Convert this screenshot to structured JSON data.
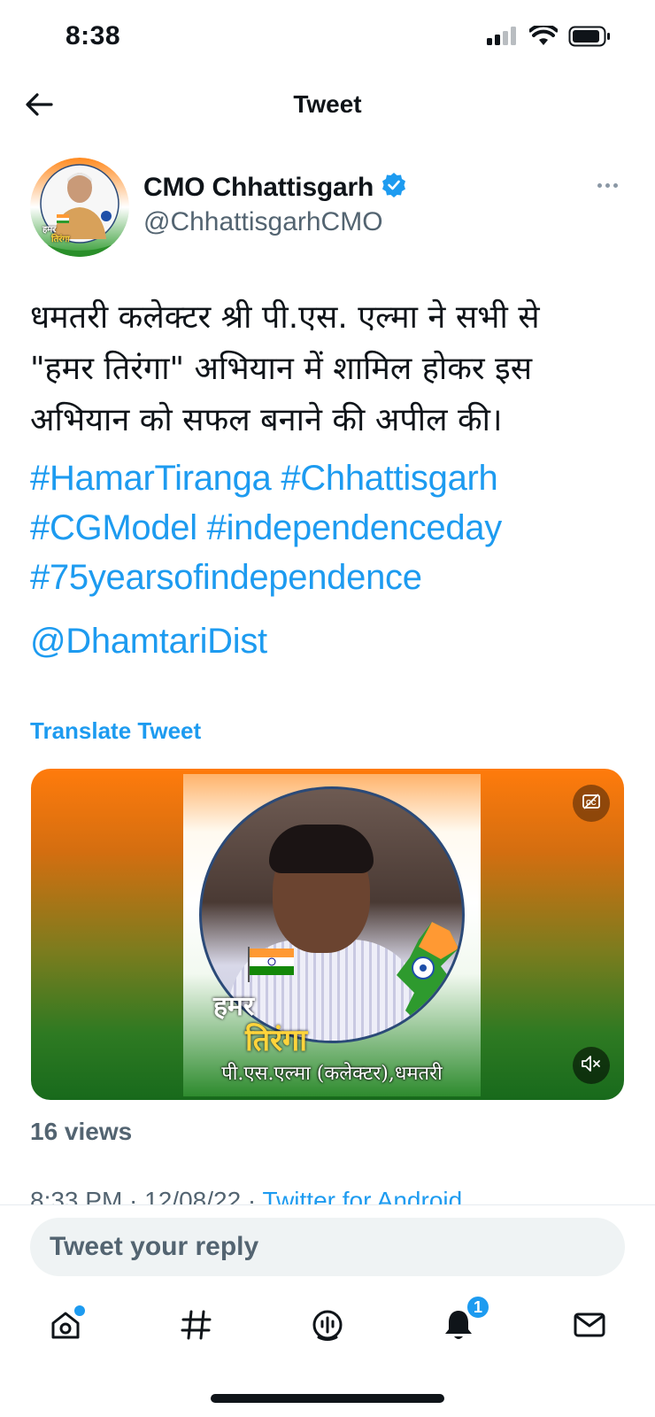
{
  "status_bar": {
    "time": "8:38",
    "icons": [
      "cellular-signal-icon",
      "wifi-icon",
      "battery-icon"
    ]
  },
  "header": {
    "title": "Tweet",
    "back_icon": "back-arrow-icon"
  },
  "author": {
    "name": "CMO Chhattisgarh",
    "handle": "@ChhattisgarhCMO",
    "verified": true,
    "avatar_text_line1": "हमर",
    "avatar_text_line2": "तिरंगा"
  },
  "tweet": {
    "text_line1": "धमतरी कलेक्टर श्री पी.एस. एल्मा ने सभी से",
    "text_line2": "\"हमर तिरंगा\" अभियान में शामिल होकर इस",
    "text_line3": "अभियान को सफल बनाने की अपील की।",
    "hashtags": [
      "#HamarTiranga",
      "#Chhattisgarh",
      "#CGModel",
      "#independenceday",
      "#75yearsofindependence"
    ],
    "mention": "@DhamtariDist",
    "translate_label": "Translate Tweet"
  },
  "media": {
    "overlay_title": "हमर",
    "overlay_subtitle": "तिरंगा",
    "caption": "पी.एस.एल्मा (कलेक्टर),धमतरी",
    "cc_icon": "closed-captions-icon",
    "mute_icon": "muted-speaker-icon"
  },
  "stats": {
    "views": "16 views",
    "timestamp": "8:33 PM · 12/08/22 · ",
    "source": "Twitter for Android"
  },
  "reply": {
    "placeholder": "Tweet your reply"
  },
  "tabbar": {
    "tabs": [
      "home-icon",
      "explore-hashtag-icon",
      "spaces-icon",
      "notifications-icon",
      "messages-icon"
    ],
    "notifications_count": "1"
  },
  "colors": {
    "accent": "#1d9bf0",
    "text": "#0f1419",
    "secondary": "#536471"
  }
}
